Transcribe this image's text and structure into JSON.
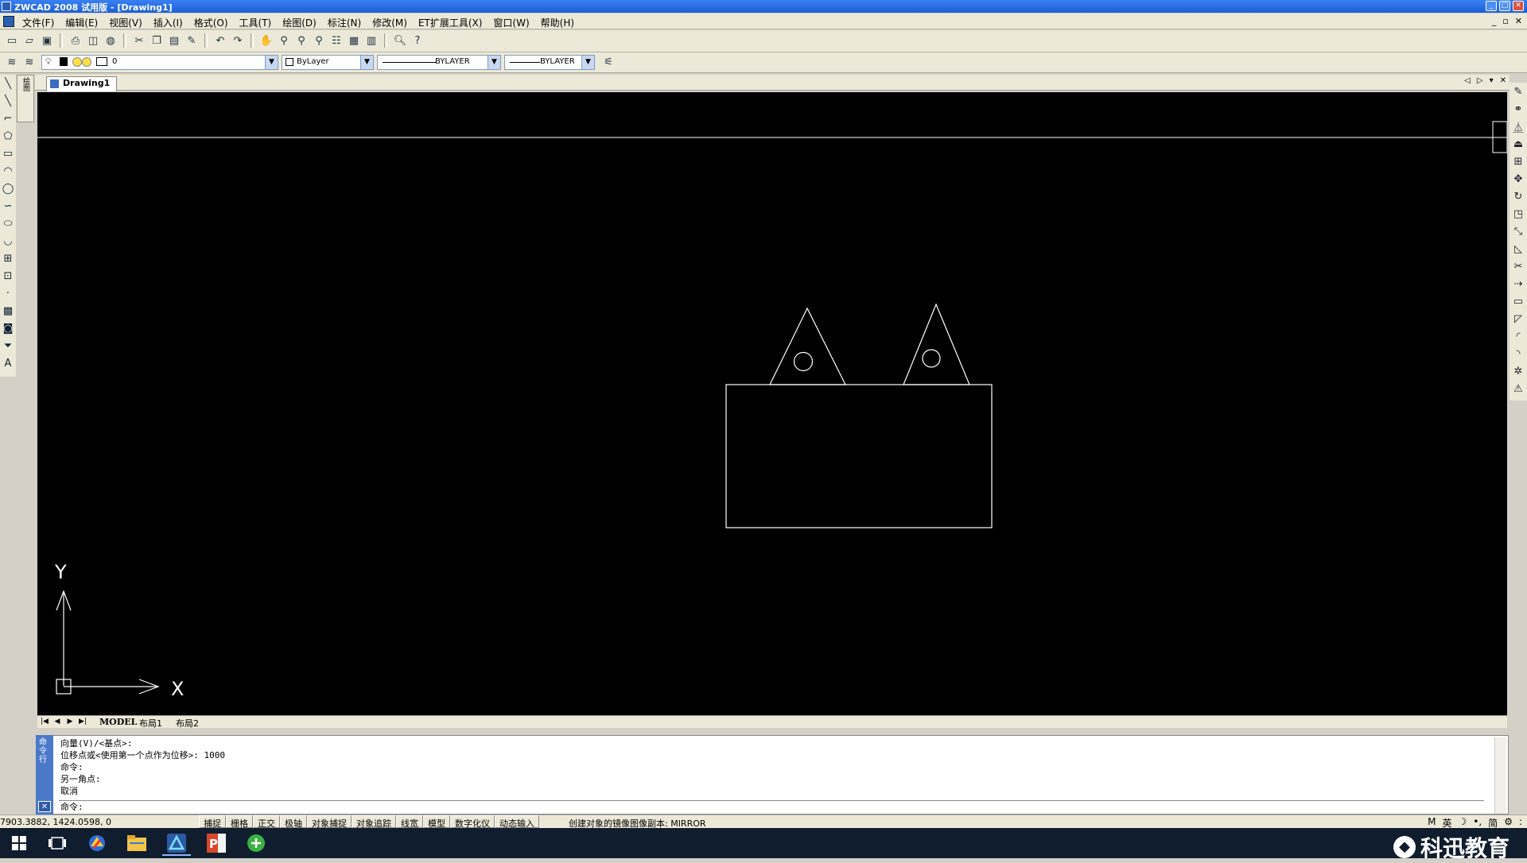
{
  "window": {
    "title": "ZWCAD 2008 试用版 - [Drawing1]",
    "controls": [
      "_",
      "□",
      "✕"
    ]
  },
  "menu": {
    "items": [
      "文件(F)",
      "编辑(E)",
      "视图(V)",
      "插入(I)",
      "格式(O)",
      "工具(T)",
      "绘图(D)",
      "标注(N)",
      "修改(M)",
      "ET扩展工具(X)",
      "窗口(W)",
      "帮助(H)"
    ],
    "child_controls": [
      "_",
      "▫",
      "✕"
    ]
  },
  "toolbar2": {
    "layer_value": "0",
    "color_value": "ByLayer",
    "linetype_value": "BYLAYER",
    "lineweight_value": "BYLAYER"
  },
  "left_strip": {
    "label": "绘图"
  },
  "doc_tab": {
    "label": "Drawing1",
    "nav": [
      "◁",
      "▷",
      "▾",
      "✕"
    ]
  },
  "layout_tabs": {
    "tabs": [
      "MODEL",
      "布局1",
      "布局2"
    ]
  },
  "ucs": {
    "x_label": "X",
    "y_label": "Y"
  },
  "command": {
    "sidebar_label": "命令行",
    "history": [
      "向量(V)/<基点>:",
      "位移点或<使用第一个点作为位移>: 1000",
      "命令:",
      "另一角点:",
      "取消"
    ],
    "prompt": "命令:",
    "close": "✕"
  },
  "status": {
    "coords": "7903.3882, 1424.0598, 0",
    "buttons": [
      "捕捉",
      "栅格",
      "正交",
      "极轴",
      "对象捕捉",
      "对象追踪",
      "线宽",
      "模型",
      "数字化仪",
      "动态输入"
    ],
    "message": "创建对象的镜像图像副本:  MIRROR",
    "right_icons": [
      "M",
      "英",
      "☽",
      "•,",
      "简",
      "⚙",
      ":"
    ]
  },
  "taskbar": {
    "watermark": "科迅教育"
  }
}
